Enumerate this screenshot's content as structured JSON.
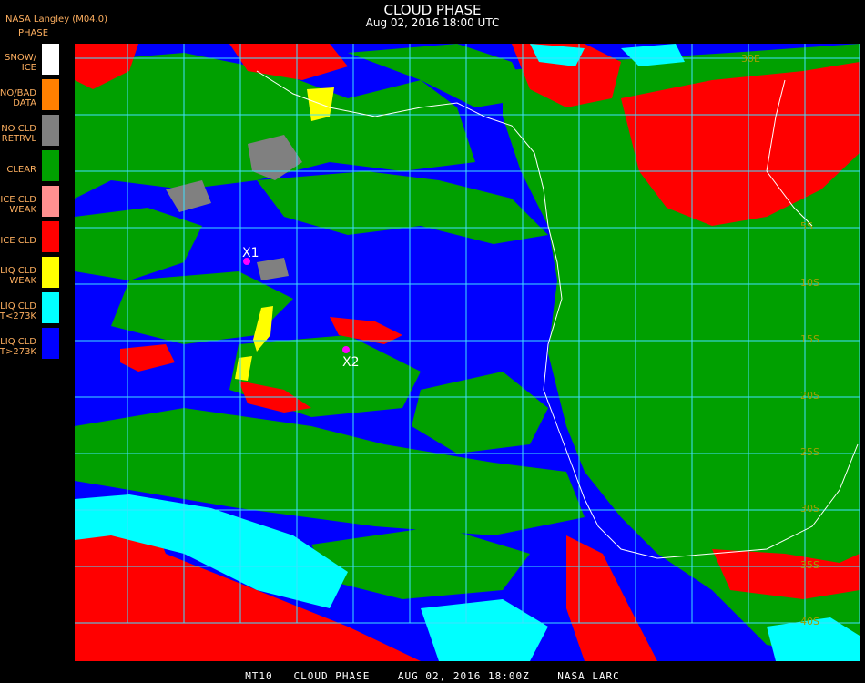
{
  "header": {
    "title": "CLOUD PHASE",
    "subtitle": "Aug 02, 2016 18:00 UTC",
    "org": "NASA Langley (M04.0)",
    "legend_title": "PHASE"
  },
  "legend": [
    {
      "label": "SNOW/\nICE",
      "color": "#ffffff"
    },
    {
      "label": "NO/BAD\nDATA",
      "color": "#ff8000"
    },
    {
      "label": "NO CLD\nRETRVL",
      "color": "#808080"
    },
    {
      "label": "CLEAR",
      "color": "#00a000"
    },
    {
      "label": "ICE CLD\nWEAK",
      "color": "#ff9090"
    },
    {
      "label": "ICE CLD",
      "color": "#ff0000"
    },
    {
      "label": "LIQ CLD\nWEAK",
      "color": "#ffff00"
    },
    {
      "label": "LIQ CLD\nT<273K",
      "color": "#00ffff"
    },
    {
      "label": "LIQ CLD\nT>273K",
      "color": "#0000ff"
    }
  ],
  "map": {
    "lat_labels": [
      "5S",
      "10S",
      "15S",
      "20S",
      "25S",
      "30S",
      "35S",
      "40S"
    ],
    "lon_labels": [
      "30E"
    ],
    "markers": [
      {
        "label": "X1",
        "color": "#ff00ff"
      },
      {
        "label": "X2",
        "color": "#ff00ff"
      }
    ],
    "grid_color": "#40e0ff",
    "coast_color": "#ffffff"
  },
  "footer": "MT10   CLOUD PHASE    AUG 02, 2016 18:00Z    NASA LARC"
}
